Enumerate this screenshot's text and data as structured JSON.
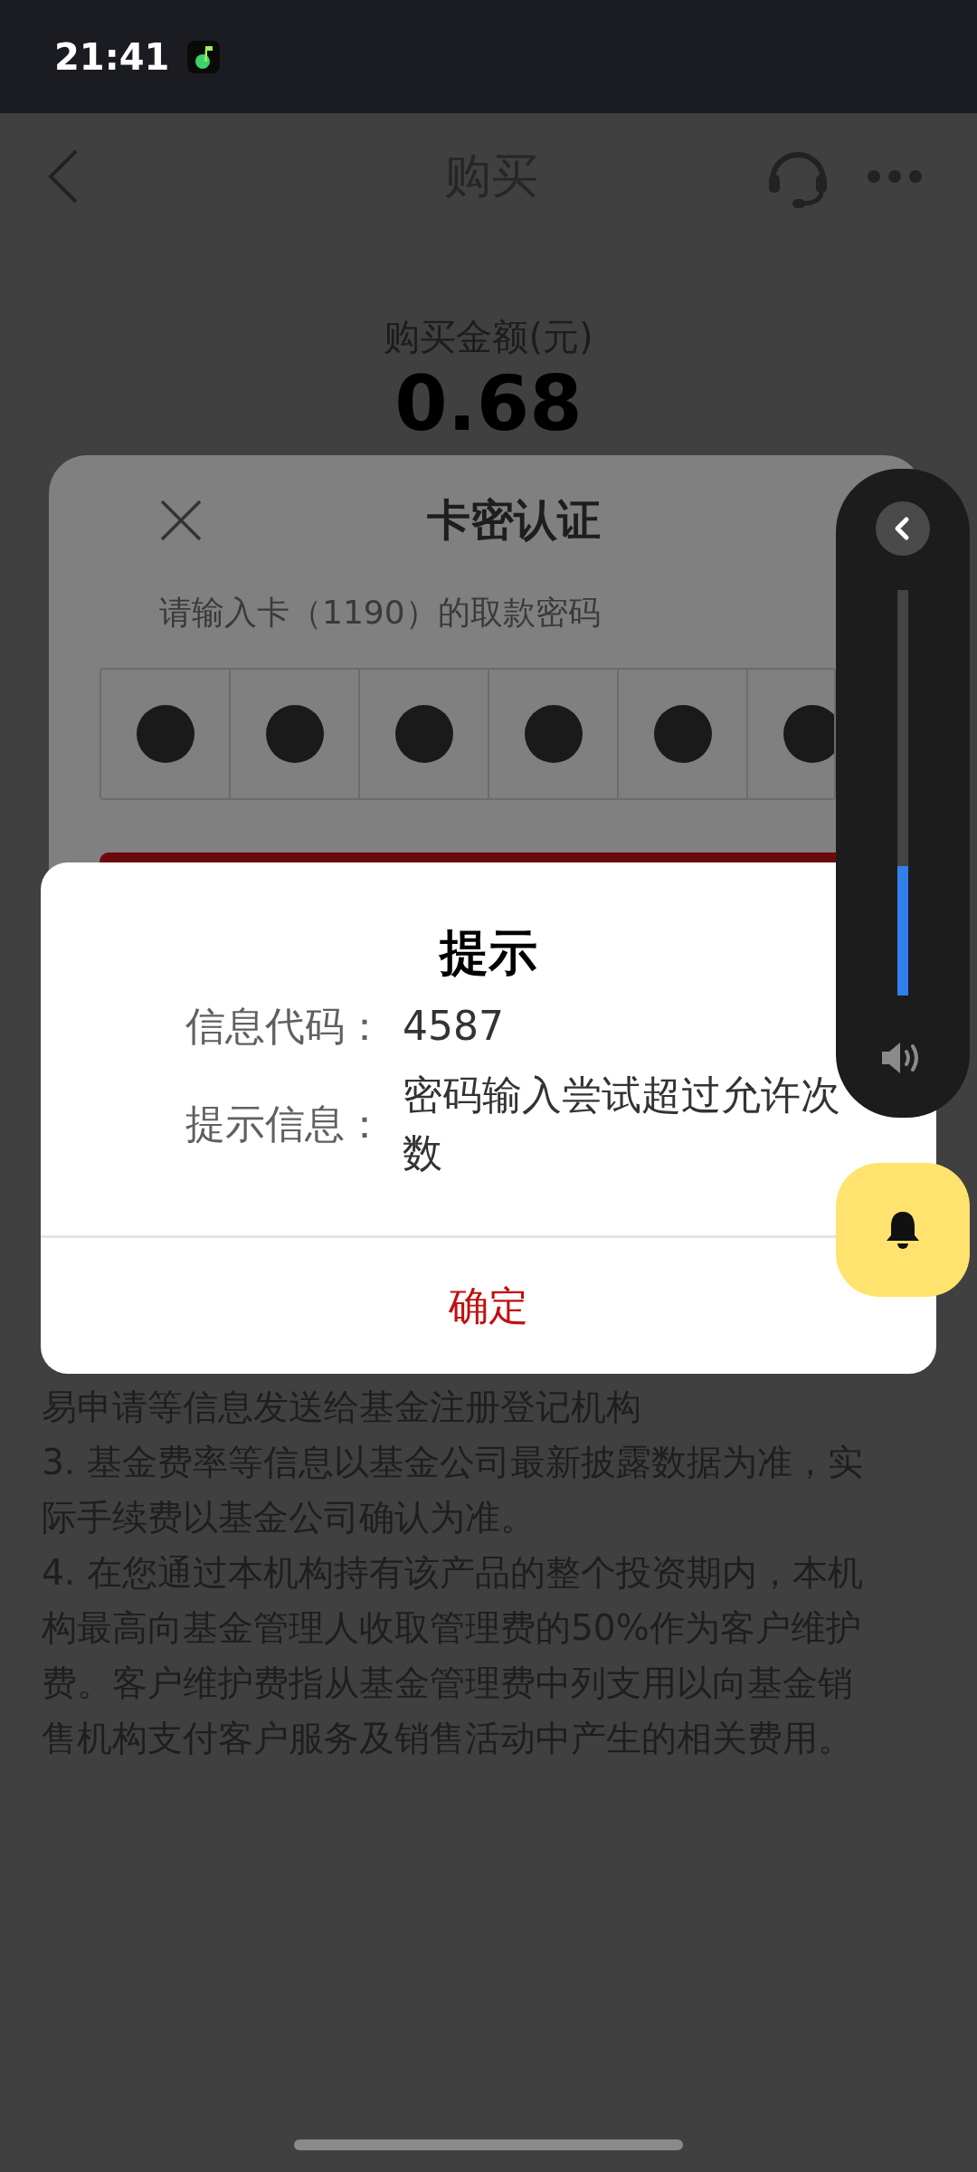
{
  "status_bar": {
    "time": "21:41"
  },
  "header": {
    "title": "购买"
  },
  "amount": {
    "label": "购买金额(元)",
    "value": "0.68"
  },
  "disclosure_lines": [
    "易申请等信息发送给基金注册登记机构",
    "3. 基金费率等信息以基金公司最新披露数据为准，实",
    "际手续费以基金公司确认为准。",
    "4. 在您通过本机构持有该产品的整个投资期内，本机",
    "构最高向基金管理人收取管理费的50%作为客户维护",
    "费。客户维护费指从基金管理费中列支用以向基金销",
    "售机构支付客户服务及销售活动中产生的相关费用。"
  ],
  "card_dialog": {
    "title": "卡密认证",
    "prompt": "请输入卡（1190）的取款密码",
    "pin_cells": [
      {
        "filled": true
      },
      {
        "filled": true
      },
      {
        "filled": true
      },
      {
        "filled": true
      },
      {
        "filled": true
      },
      {
        "filled": true
      }
    ]
  },
  "alert": {
    "title": "提示",
    "rows": [
      {
        "label": "信息代码：",
        "value": "4587"
      },
      {
        "label": "提示信息：",
        "value": "密码输入尝试超过允许次数"
      }
    ],
    "button": "确定"
  },
  "volume": {
    "level": 0.32
  }
}
